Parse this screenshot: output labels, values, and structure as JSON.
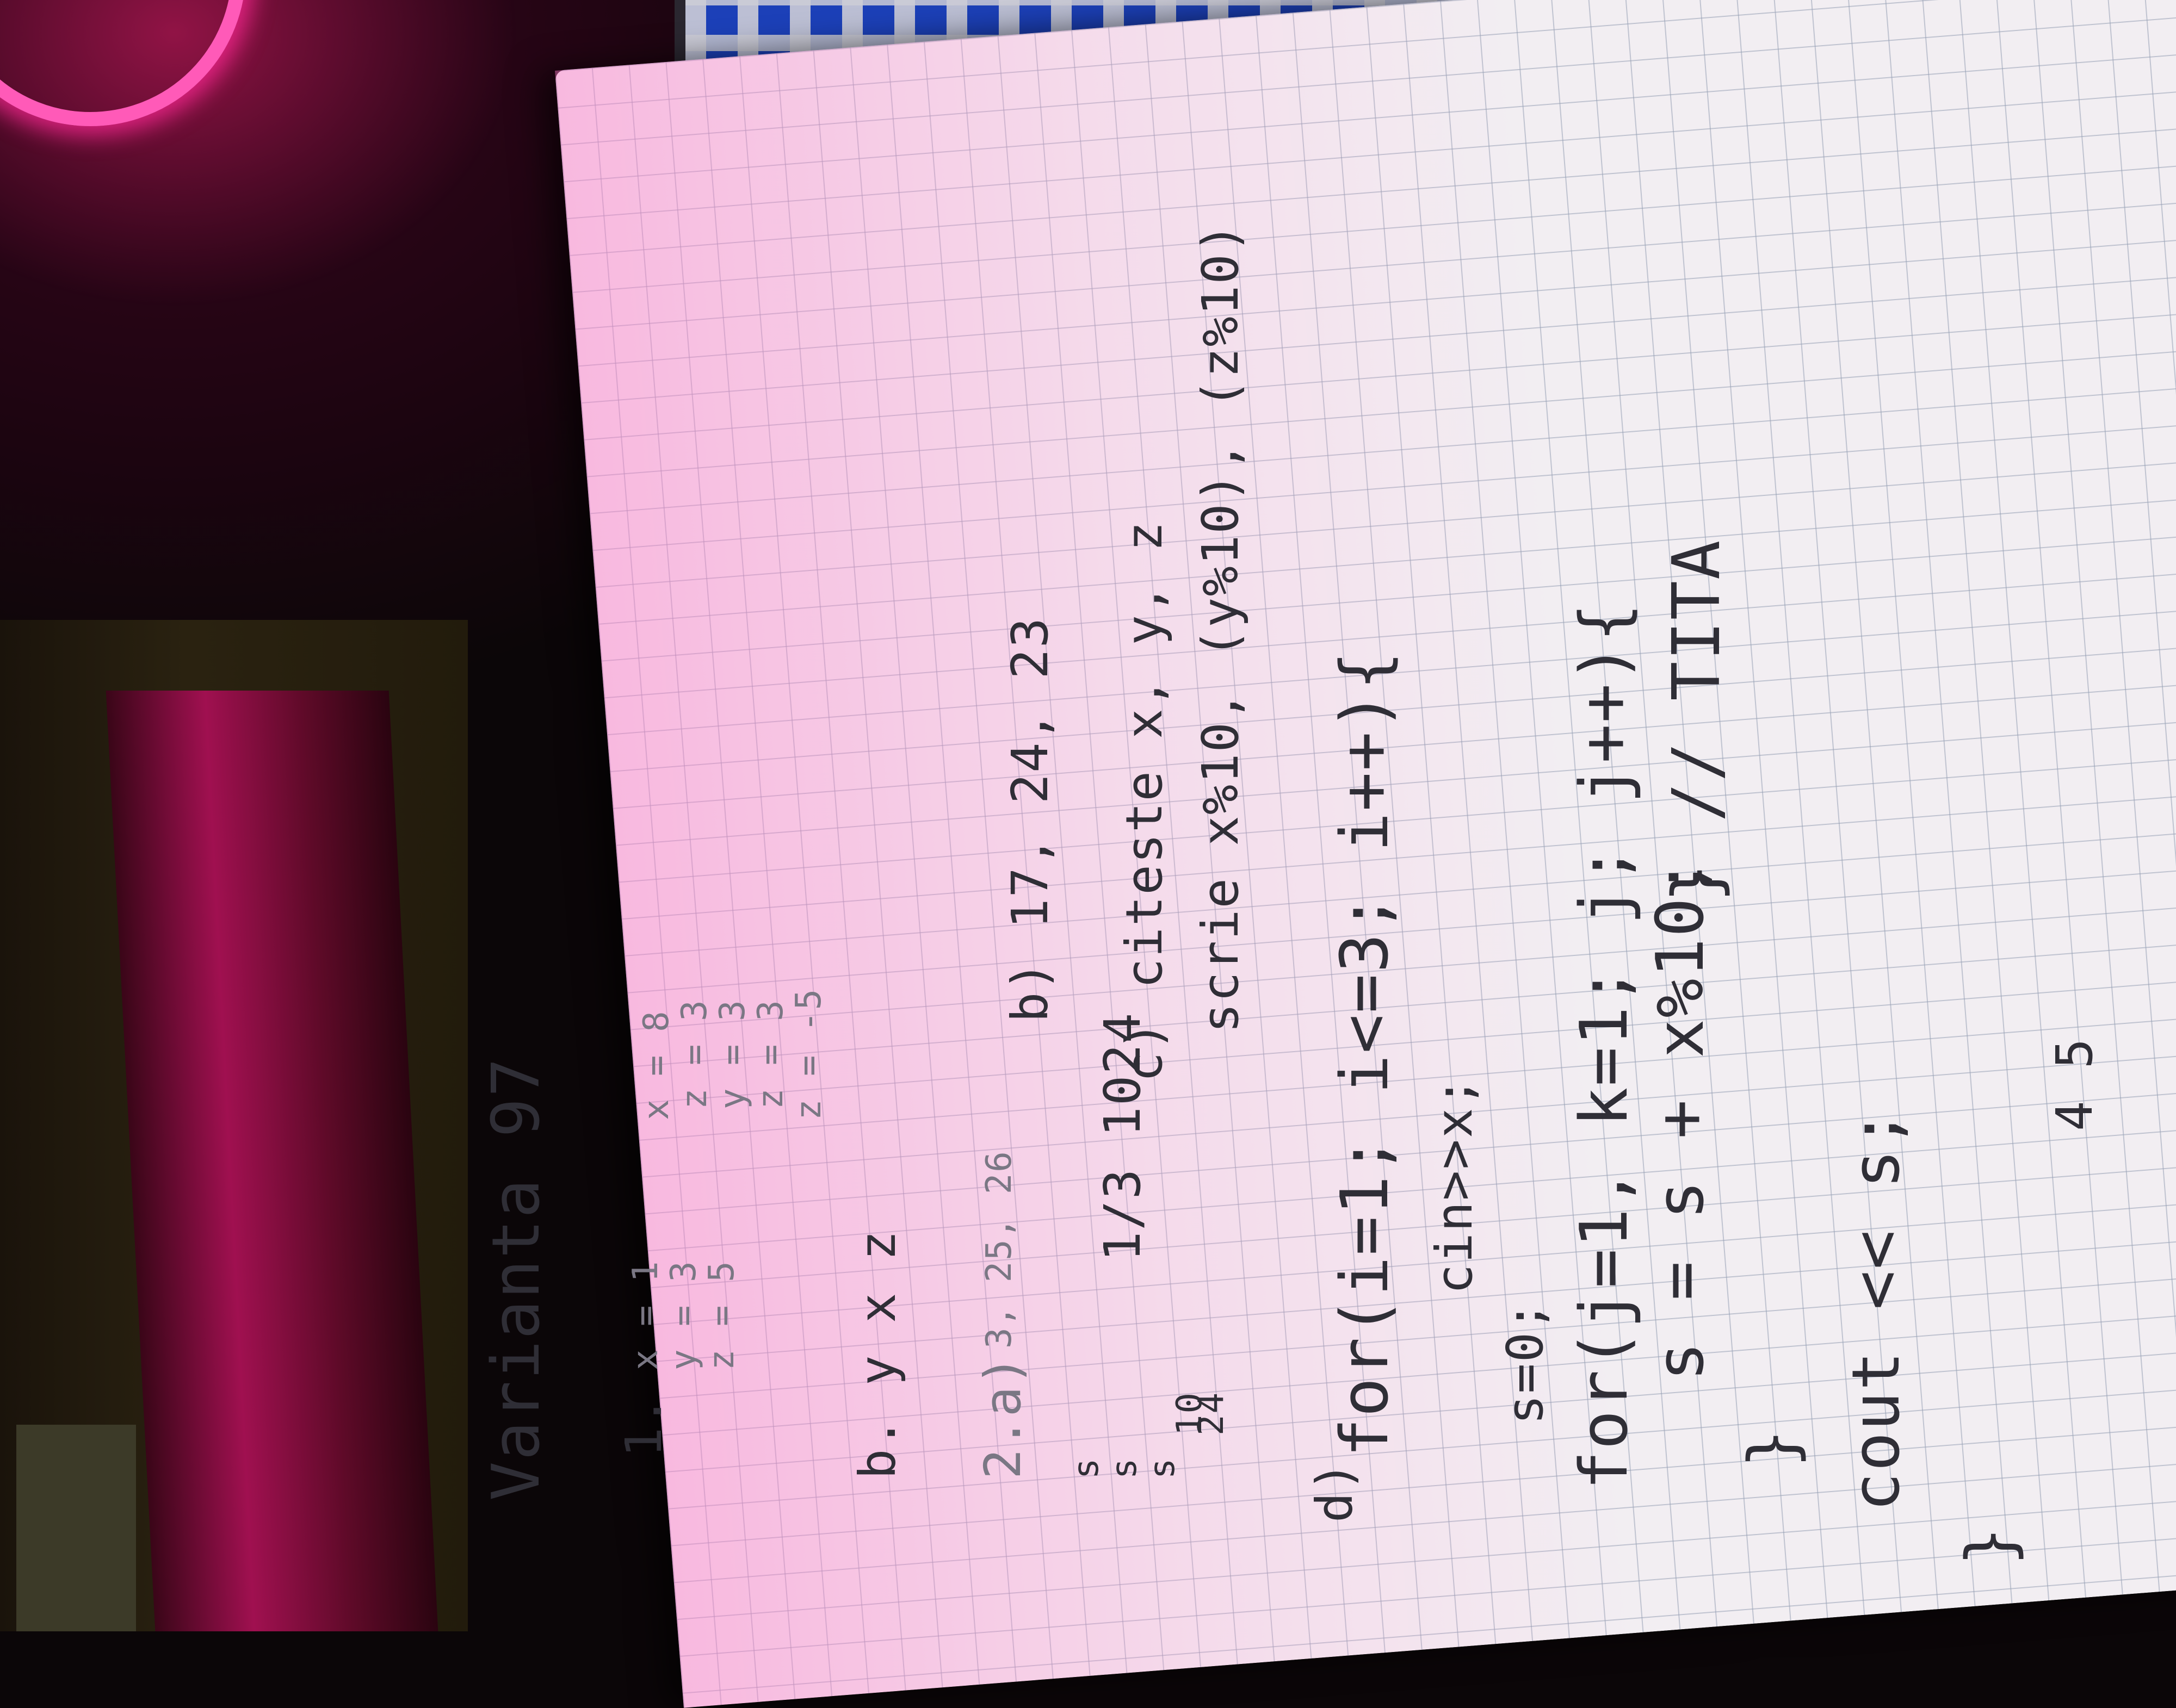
{
  "notebook": {
    "title": "Varianta 97",
    "ex1": {
      "label": "1.",
      "lines": [
        "x = 1",
        "y = 3",
        "z = 5"
      ],
      "trace": [
        "x = 8",
        "z = 3",
        "y = 3",
        "z = 3",
        "z = -5"
      ],
      "answer": "b. y x z"
    },
    "ex2": {
      "label": "2.a)",
      "values": "3, 25, 26",
      "trace_col": [
        "s",
        "s",
        "s",
        "10",
        "24"
      ],
      "line": "1/3 1024",
      "b": "b) 17, 24, 23",
      "c": "c) citeste x, y, z",
      "c2": "scrie x%10, (y%10), (z%10)"
    },
    "code": {
      "label": "d)",
      "lines": [
        "for(i=1; i<=3; i++){",
        "cin>>x;",
        "s=0;",
        "for(j=1, k=1; j; j++){",
        "s = s + x%10;",
        "}",
        "cout << s;",
        "}"
      ],
      "comment": "} // TITA"
    },
    "page_numbers": "4 5"
  }
}
